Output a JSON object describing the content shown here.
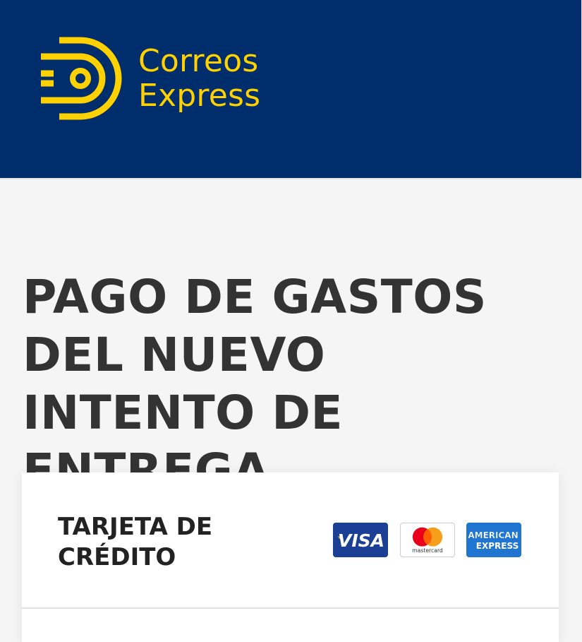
{
  "header": {
    "logo_line1": "Correos",
    "logo_line2": "Express",
    "background": "#002d6b",
    "accent": "#ffd100"
  },
  "page": {
    "title": "PAGO DE GASTOS DEL NUEVO INTENTO DE ENTREGA"
  },
  "payment": {
    "method_title": "TARJETA DE CRÉDITO",
    "brands": [
      {
        "name": "visa-icon",
        "label": "VISA"
      },
      {
        "name": "mastercard-icon",
        "label": "mastercard"
      },
      {
        "name": "amex-icon",
        "label_line1": "AMERICAN",
        "label_line2": "EXPRESS"
      }
    ]
  }
}
